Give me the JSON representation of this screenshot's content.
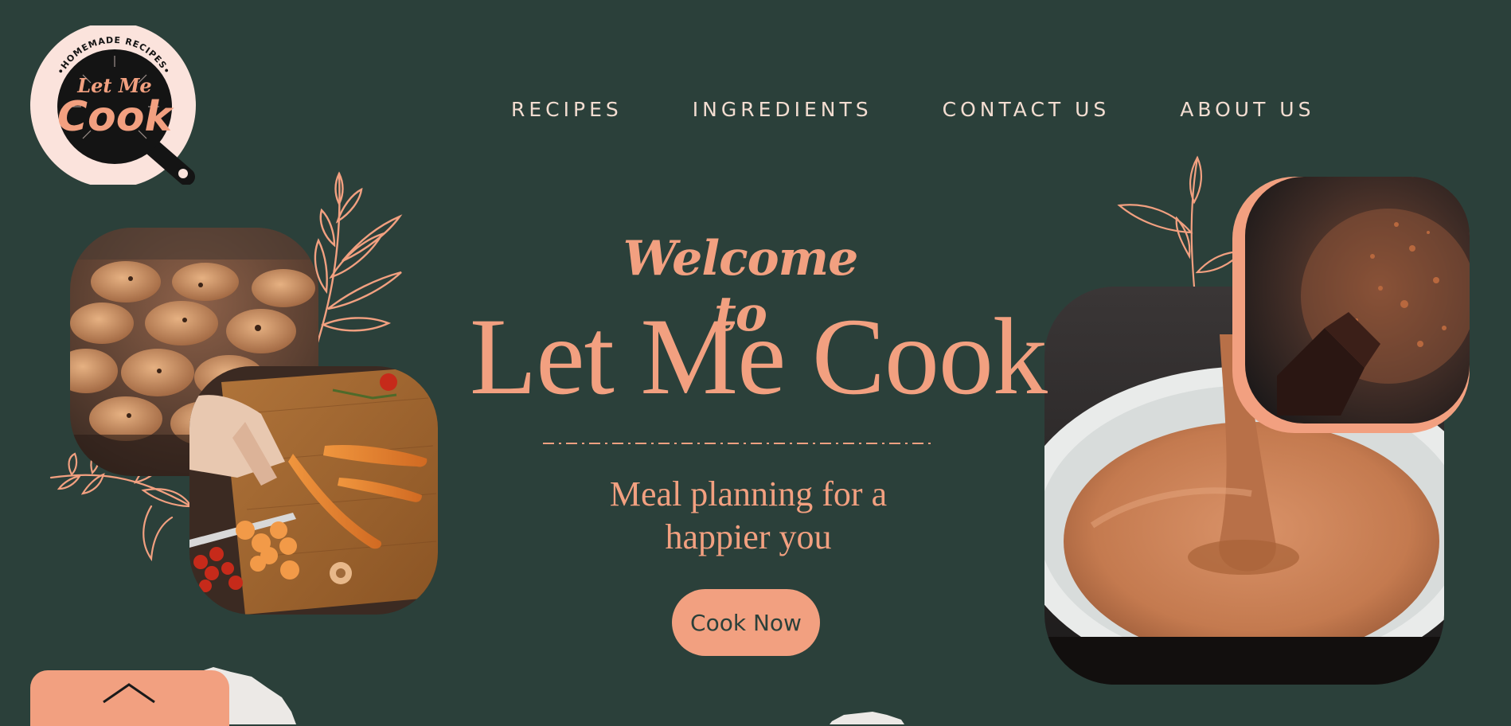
{
  "logo": {
    "arc_text": "•HOMEMADE RECIPES•",
    "line1": "Let Me",
    "line2": "Cook"
  },
  "nav": {
    "items": [
      {
        "label": "RECIPES"
      },
      {
        "label": "INGREDIENTS"
      },
      {
        "label": "CONTACT US"
      },
      {
        "label": "ABOUT US"
      }
    ]
  },
  "hero": {
    "welcome": "Welcome to",
    "title": "Let Me Cook",
    "tagline_line1": "Meal planning for a",
    "tagline_line2": "happier you",
    "cta_label": "Cook Now"
  },
  "colors": {
    "background": "#2b403a",
    "accent": "#f2a080",
    "nav_text": "#f3ddd1"
  },
  "icons": {
    "scroll_top": "chevron-up-icon"
  }
}
